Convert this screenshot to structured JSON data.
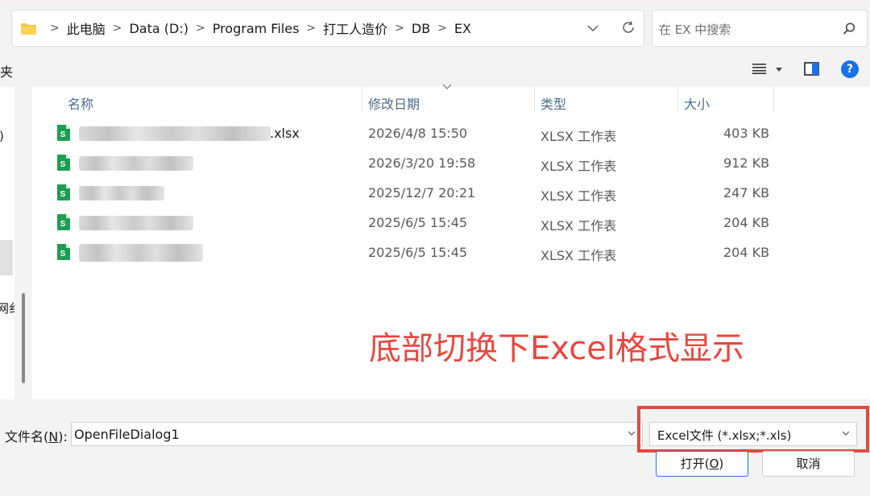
{
  "address": {
    "crumbs": [
      "此电脑",
      "Data (D:)",
      "Program Files",
      "打工人造价",
      "DB",
      "EX"
    ],
    "separator": ">"
  },
  "search": {
    "placeholder": "在 EX 中搜索"
  },
  "toolbar": {
    "left_text": "夹"
  },
  "nav": {
    "items": [
      ":)",
      ")",
      ")",
      "网纟"
    ]
  },
  "columns": {
    "name": "名称",
    "date": "修改日期",
    "type": "类型",
    "size": "大小"
  },
  "files": [
    {
      "name_visible": ".xlsx",
      "date": "2026/4/8 15:50",
      "type": "XLSX 工作表",
      "size": "403 KB"
    },
    {
      "name_visible": "",
      "date": "2026/3/20 19:58",
      "type": "XLSX 工作表",
      "size": "912 KB"
    },
    {
      "name_visible": "",
      "date": "2025/12/7 20:21",
      "type": "XLSX 工作表",
      "size": "247 KB"
    },
    {
      "name_visible": "",
      "date": "2025/6/5 15:45",
      "type": "XLSX 工作表",
      "size": "204 KB"
    },
    {
      "name_visible": "",
      "date": "2025/6/5 15:45",
      "type": "XLSX 工作表",
      "size": "204 KB"
    }
  ],
  "annotation": "底部切换下Excel格式显示",
  "bottom": {
    "filename_label": "文件名(",
    "filename_key": "N",
    "filename_label_end": "):",
    "filename_value": "OpenFileDialog1",
    "filter_value": "Excel文件 (*.xlsx;*.xls)",
    "open_label": "打开(",
    "open_key": "O",
    "open_label_end": ")",
    "cancel_label": "取消"
  },
  "colors": {
    "accent": "#1a73e8",
    "annotation": "#e8473f",
    "excel_green": "#1f9d55"
  }
}
